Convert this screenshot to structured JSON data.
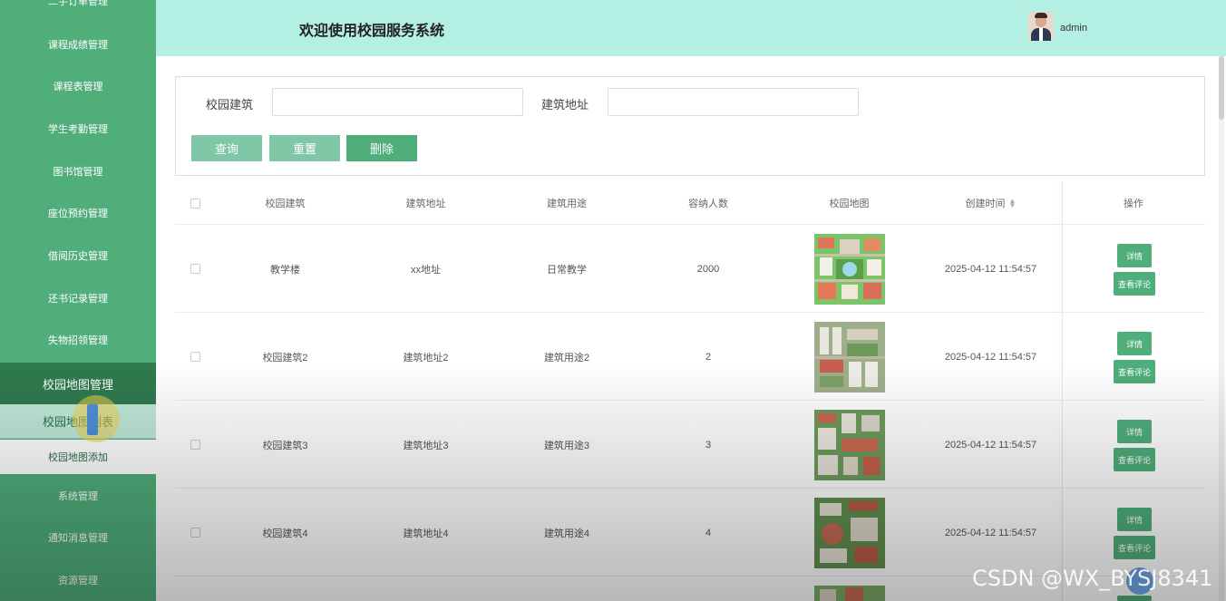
{
  "sidebar": {
    "items": [
      {
        "label": "二手订单管理"
      },
      {
        "label": "课程成绩管理"
      },
      {
        "label": "课程表管理"
      },
      {
        "label": "学生考勤管理"
      },
      {
        "label": "图书馆管理"
      },
      {
        "label": "座位预约管理"
      },
      {
        "label": "借阅历史管理"
      },
      {
        "label": "还书记录管理"
      },
      {
        "label": "失物招领管理"
      },
      {
        "label": "校园地图管理"
      },
      {
        "label": "系统管理"
      },
      {
        "label": "通知消息管理"
      },
      {
        "label": "资源管理"
      }
    ],
    "submenu": [
      {
        "label": "校园地图列表"
      },
      {
        "label": "校园地图添加"
      }
    ]
  },
  "header": {
    "title": "欢迎使用校园服务系统",
    "username": "admin"
  },
  "search": {
    "field1_label": "校园建筑",
    "field1_value": "",
    "field2_label": "建筑地址",
    "field2_value": "",
    "query_label": "查询",
    "reset_label": "重置",
    "delete_label": "删除"
  },
  "table": {
    "columns": [
      "校园建筑",
      "建筑地址",
      "建筑用途",
      "容纳人数",
      "校园地图",
      "创建时间",
      "操作"
    ],
    "rows": [
      {
        "building": "教学楼",
        "address": "xx地址",
        "usage": "日常教学",
        "capacity": "2000",
        "created": "2025-04-12 11:54:57"
      },
      {
        "building": "校园建筑2",
        "address": "建筑地址2",
        "usage": "建筑用途2",
        "capacity": "2",
        "created": "2025-04-12 11:54:57"
      },
      {
        "building": "校园建筑3",
        "address": "建筑地址3",
        "usage": "建筑用途3",
        "capacity": "3",
        "created": "2025-04-12 11:54:57"
      },
      {
        "building": "校园建筑4",
        "address": "建筑地址4",
        "usage": "建筑用途4",
        "capacity": "4",
        "created": "2025-04-12 11:54:57"
      }
    ],
    "detail_label": "详情",
    "comment_label": "查看评论"
  },
  "watermark": "CSDN @WX_BYSJ8341",
  "colors": {
    "sidebar_bg": "#4fae7a",
    "sidebar_active": "#2f7a4f",
    "header_bg": "#b3efe2",
    "button_dark": "#4fae7a",
    "button_light": "#7fc7a6"
  }
}
